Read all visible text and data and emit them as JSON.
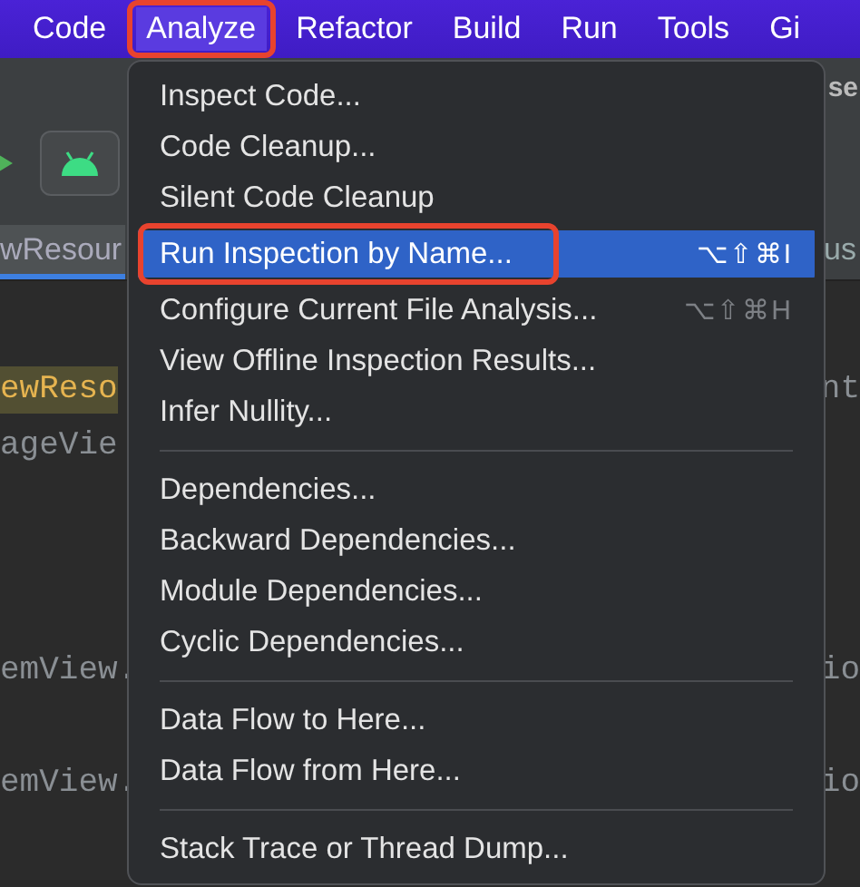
{
  "menubar": [
    {
      "label": "Code",
      "selected": false,
      "annotated": false
    },
    {
      "label": "Analyze",
      "selected": true,
      "annotated": true
    },
    {
      "label": "Refactor",
      "selected": false,
      "annotated": false
    },
    {
      "label": "Build",
      "selected": false,
      "annotated": false
    },
    {
      "label": "Run",
      "selected": false,
      "annotated": false
    },
    {
      "label": "Tools",
      "selected": false,
      "annotated": false
    },
    {
      "label": "Gi",
      "selected": false,
      "annotated": false
    }
  ],
  "toolbar": {
    "title_fragment": "se"
  },
  "editor": {
    "tabs": [
      {
        "label": "wResour",
        "selected": true
      },
      {
        "label": "us",
        "selected": false
      }
    ],
    "lines": [
      {
        "kind": "code",
        "left": "ewReso",
        "right": "nt",
        "highlighted": true
      },
      {
        "kind": "code",
        "left": "ageVie",
        "highlighted": false
      },
      {
        "kind": "blank"
      },
      {
        "kind": "blank"
      },
      {
        "kind": "blank"
      },
      {
        "kind": "code",
        "left": "emView.",
        "right": "io",
        "highlighted": false
      },
      {
        "kind": "blank"
      },
      {
        "kind": "code",
        "left": "emView.",
        "right": "io",
        "highlighted": false
      }
    ]
  },
  "menu": [
    {
      "kind": "item",
      "label": "Inspect Code...",
      "selected": false,
      "annotated": false
    },
    {
      "kind": "item",
      "label": "Code Cleanup...",
      "selected": false,
      "annotated": false
    },
    {
      "kind": "item",
      "label": "Silent Code Cleanup",
      "selected": false,
      "annotated": false
    },
    {
      "kind": "item",
      "label": "Run Inspection by Name...",
      "shortcut": "⌥⇧⌘I",
      "selected": true,
      "annotated": true
    },
    {
      "kind": "item",
      "label": "Configure Current File Analysis...",
      "shortcut": "⌥⇧⌘H",
      "selected": false,
      "annotated": false
    },
    {
      "kind": "item",
      "label": "View Offline Inspection Results...",
      "selected": false,
      "annotated": false
    },
    {
      "kind": "item",
      "label": "Infer Nullity...",
      "selected": false,
      "annotated": false
    },
    {
      "kind": "separator"
    },
    {
      "kind": "item",
      "label": "Dependencies...",
      "selected": false,
      "annotated": false
    },
    {
      "kind": "item",
      "label": "Backward Dependencies...",
      "selected": false,
      "annotated": false
    },
    {
      "kind": "item",
      "label": "Module Dependencies...",
      "selected": false,
      "annotated": false
    },
    {
      "kind": "item",
      "label": "Cyclic Dependencies...",
      "selected": false,
      "annotated": false
    },
    {
      "kind": "separator"
    },
    {
      "kind": "item",
      "label": "Data Flow to Here...",
      "selected": false,
      "annotated": false
    },
    {
      "kind": "item",
      "label": "Data Flow from Here...",
      "selected": false,
      "annotated": false
    },
    {
      "kind": "separator"
    },
    {
      "kind": "item",
      "label": "Stack Trace or Thread Dump...",
      "selected": false,
      "annotated": false
    }
  ]
}
